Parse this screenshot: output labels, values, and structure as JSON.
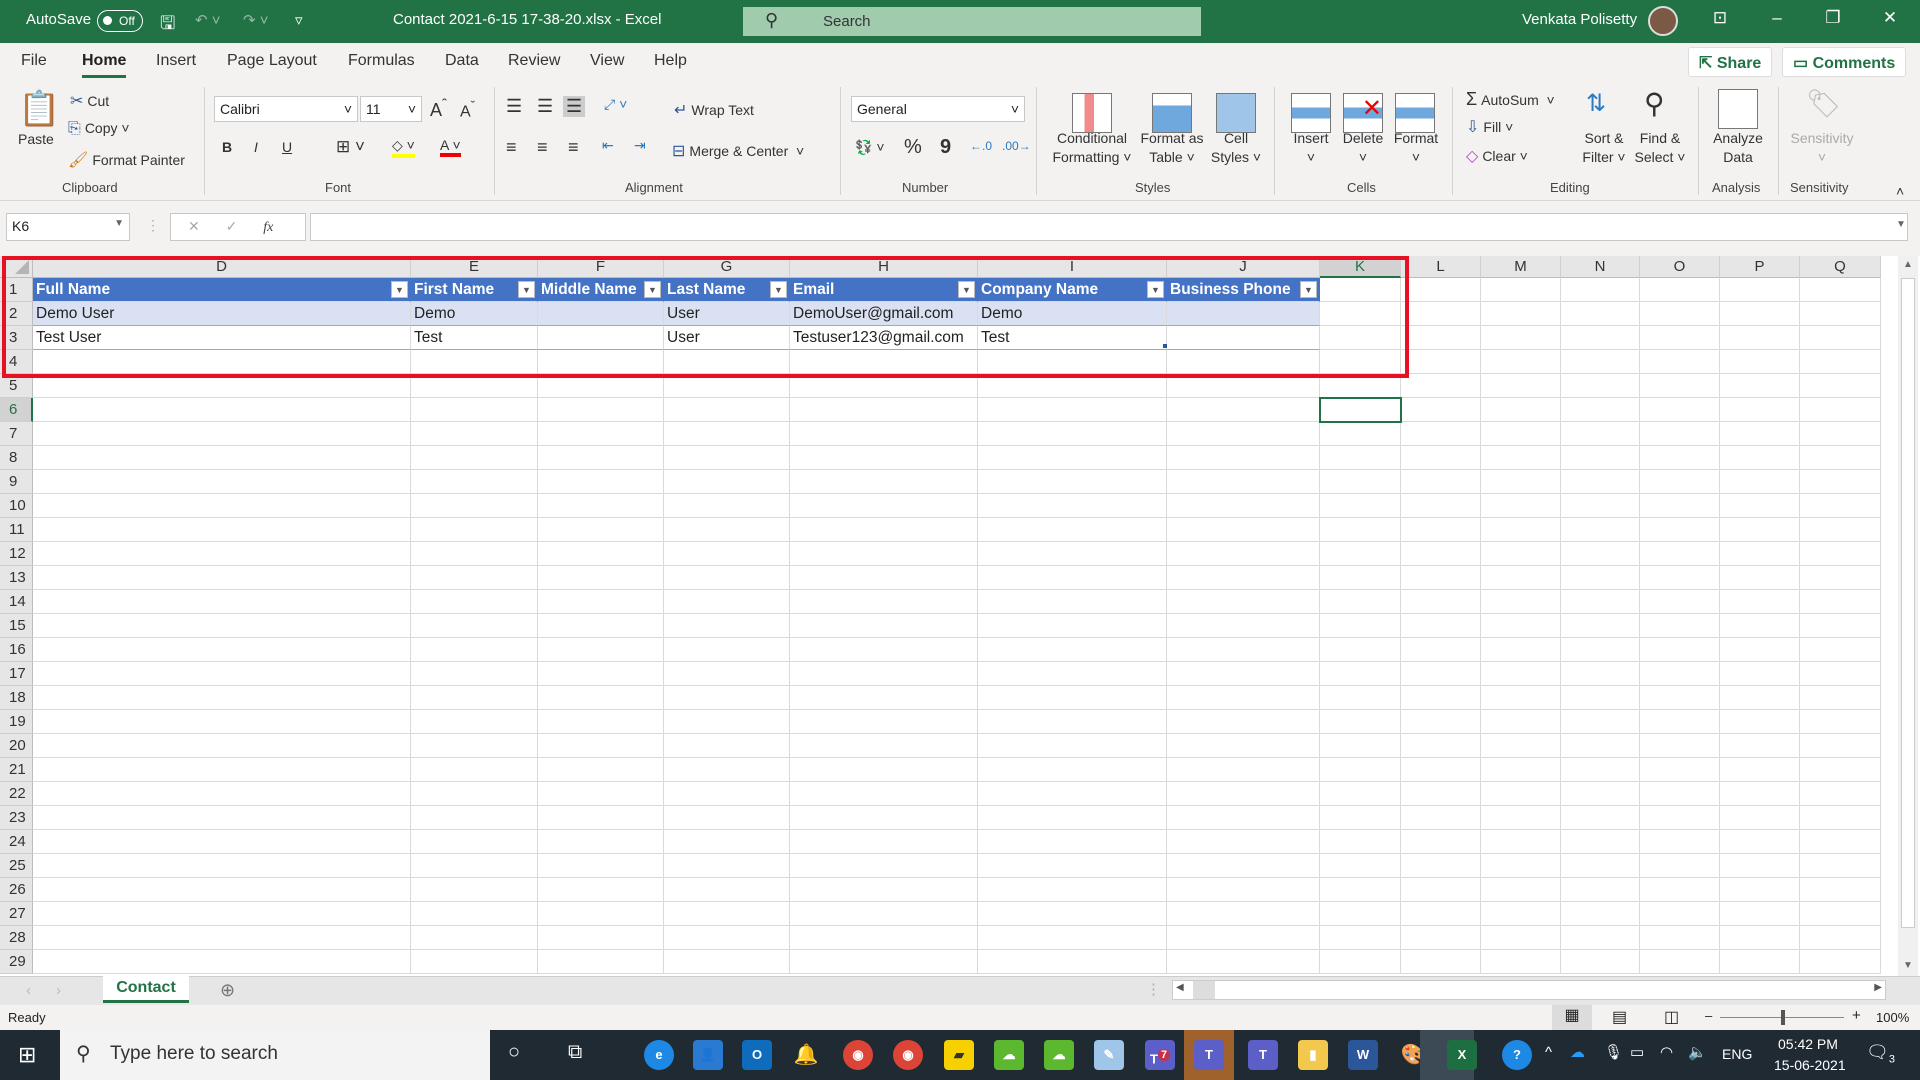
{
  "titlebar": {
    "autosave": "AutoSave",
    "autosave_state": "Off",
    "title": "Contact 2021-6-15 17-38-20.xlsx  -  Excel",
    "search": "Search",
    "user": "Venkata Polisetty"
  },
  "menu": [
    "File",
    "Home",
    "Insert",
    "Page Layout",
    "Formulas",
    "Data",
    "Review",
    "View",
    "Help"
  ],
  "share": "Share",
  "comments": "Comments",
  "ribbon": {
    "clipboard": {
      "paste": "Paste",
      "cut": "Cut",
      "copy": "Copy",
      "format_painter": "Format Painter",
      "label": "Clipboard"
    },
    "font": {
      "name": "Calibri",
      "size": "11",
      "bold": "B",
      "italic": "I",
      "underline": "U",
      "label": "Font"
    },
    "alignment": {
      "wrap": "Wrap Text",
      "merge": "Merge & Center",
      "label": "Alignment"
    },
    "number": {
      "format": "General",
      "percent": "%",
      "comma": "9",
      "label": "Number"
    },
    "styles": {
      "conditional": "Conditional\nFormatting ˅",
      "format_table": "Format as\nTable ˅",
      "cell_styles": "Cell\nStyles ˅",
      "label": "Styles"
    },
    "cells": {
      "insert": "Insert",
      "delete": "Delete",
      "format": "Format",
      "label": "Cells"
    },
    "editing": {
      "autosum": "AutoSum",
      "fill": "Fill",
      "clear": "Clear",
      "sort": "Sort &\nFilter ˅",
      "find": "Find &\nSelect ˅",
      "label": "Editing"
    },
    "analysis": {
      "analyze": "Analyze\nData",
      "label": "Analysis"
    },
    "sensitivity": {
      "sensitivity": "Sensitivity",
      "label": "Sensitivity"
    }
  },
  "formula_bar": {
    "name_box": "K6",
    "fx": "fx",
    "value": ""
  },
  "columns": [
    "D",
    "E",
    "F",
    "G",
    "H",
    "I",
    "J",
    "K",
    "L",
    "M",
    "N",
    "O",
    "P",
    "Q"
  ],
  "active_column": "K",
  "table": {
    "headers": [
      "Full Name",
      "First Name",
      "Middle Name",
      "Last Name",
      "Email",
      "Company Name",
      "Business Phone"
    ],
    "rows": [
      [
        "Demo User",
        "Demo",
        "",
        "User",
        "DemoUser@gmail.com",
        "Demo",
        ""
      ],
      [
        "Test User",
        "Test",
        "",
        "User",
        "Testuser123@gmail.com",
        "Test",
        ""
      ]
    ]
  },
  "row_count": 29,
  "sheet_tab": "Contact",
  "status": {
    "ready": "Ready",
    "zoom": "100%"
  },
  "taskbar": {
    "search": "Type here to search",
    "time": "05:42 PM",
    "date": "15-06-2021",
    "lang": "ENG",
    "teams_badge": "7",
    "notif": "3"
  }
}
